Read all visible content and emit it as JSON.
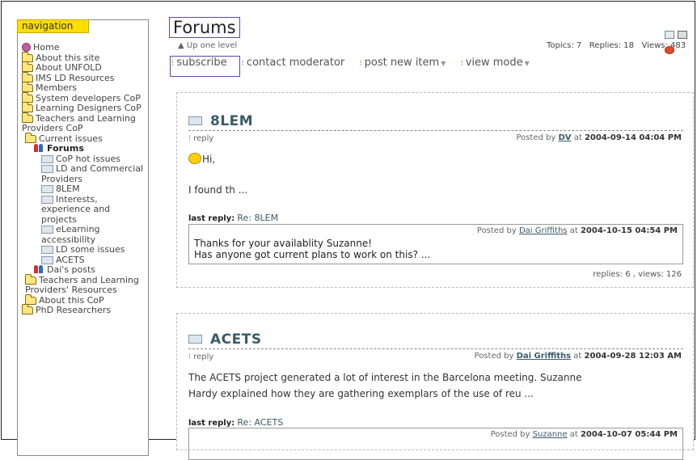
{
  "sidebar": {
    "tab_label": "navigation",
    "items": [
      {
        "icon": "home-icon",
        "label": "Home"
      },
      {
        "icon": "folder-icon",
        "label": "About this site"
      },
      {
        "icon": "folder-icon",
        "label": "About UNFOLD"
      },
      {
        "icon": "folder-icon",
        "label": "IMS LD Resources"
      },
      {
        "icon": "folder-icon",
        "label": "Members"
      },
      {
        "icon": "folder-icon",
        "label": "System developers CoP"
      },
      {
        "icon": "folder-icon",
        "label": "Learning Designers CoP"
      },
      {
        "icon": "folder-icon",
        "label": "Teachers and Learning Providers CoP"
      },
      {
        "icon": "folder-icon",
        "label": "Current issues"
      },
      {
        "icon": "people-icon",
        "label": "Forums"
      },
      {
        "icon": "mail-icon",
        "label": "CoP hot issues"
      },
      {
        "icon": "mail-icon",
        "label": "LD and Commercial Providers"
      },
      {
        "icon": "mail-icon",
        "label": "8LEM"
      },
      {
        "icon": "mail-icon",
        "label": "Interests, experience and projects"
      },
      {
        "icon": "mail-icon",
        "label": "eLearning accessibility"
      },
      {
        "icon": "mail-icon",
        "label": "LD some issues"
      },
      {
        "icon": "mail-icon",
        "label": "ACETS"
      },
      {
        "icon": "people-icon",
        "label": "Dai's posts"
      },
      {
        "icon": "folder-icon",
        "label": "Teachers and Learning Providers' Resources"
      },
      {
        "icon": "folder-icon",
        "label": "About this CoP"
      },
      {
        "icon": "folder-icon",
        "label": "PhD Researchers"
      }
    ]
  },
  "header": {
    "title": "Forums",
    "up_level": "Up one level",
    "stats": "Topics: 7   Replies: 18   Views: 483"
  },
  "actions": {
    "subscribe": "subscribe",
    "contact": "contact moderator",
    "post_new": "post new item",
    "view_mode": "view mode"
  },
  "posts": [
    {
      "title": "8LEM",
      "reply": "reply",
      "posted_prefix": "Posted by",
      "author": "DV",
      "at": "at",
      "date": "2004-09-14 04:04 PM",
      "body1": "Hi,",
      "body2": "I found th ...",
      "last_reply_label": "last reply:",
      "last_reply_link": "Re: 8LEM",
      "lr_posted_prefix": "Posted by",
      "lr_author": "Dai Griffiths",
      "lr_at": "at",
      "lr_date": "2004-10-15 04:54 PM",
      "lr_line1": "Thanks for your availablity Suzanne!",
      "lr_line2": "Has anyone got current plans to work on this? ...",
      "replies_views": "replies: 6 , views: 126"
    },
    {
      "title": "ACETS",
      "reply": "reply",
      "posted_prefix": "Posted by",
      "author": "Dai Griffiths",
      "at": "at",
      "date": "2004-09-28 12:03 AM",
      "body1": "The ACETS project generated a lot of interest in the Barcelona meeting. Suzanne",
      "body2": "Hardy explained how they are gathering exemplars of the use of reu ...",
      "last_reply_label": "last reply:",
      "last_reply_link": "Re: ACETS",
      "lr_posted_prefix": "Posted by",
      "lr_author": "Suzanne",
      "lr_at": "at",
      "lr_date": "2004-10-07 05:44 PM"
    }
  ]
}
